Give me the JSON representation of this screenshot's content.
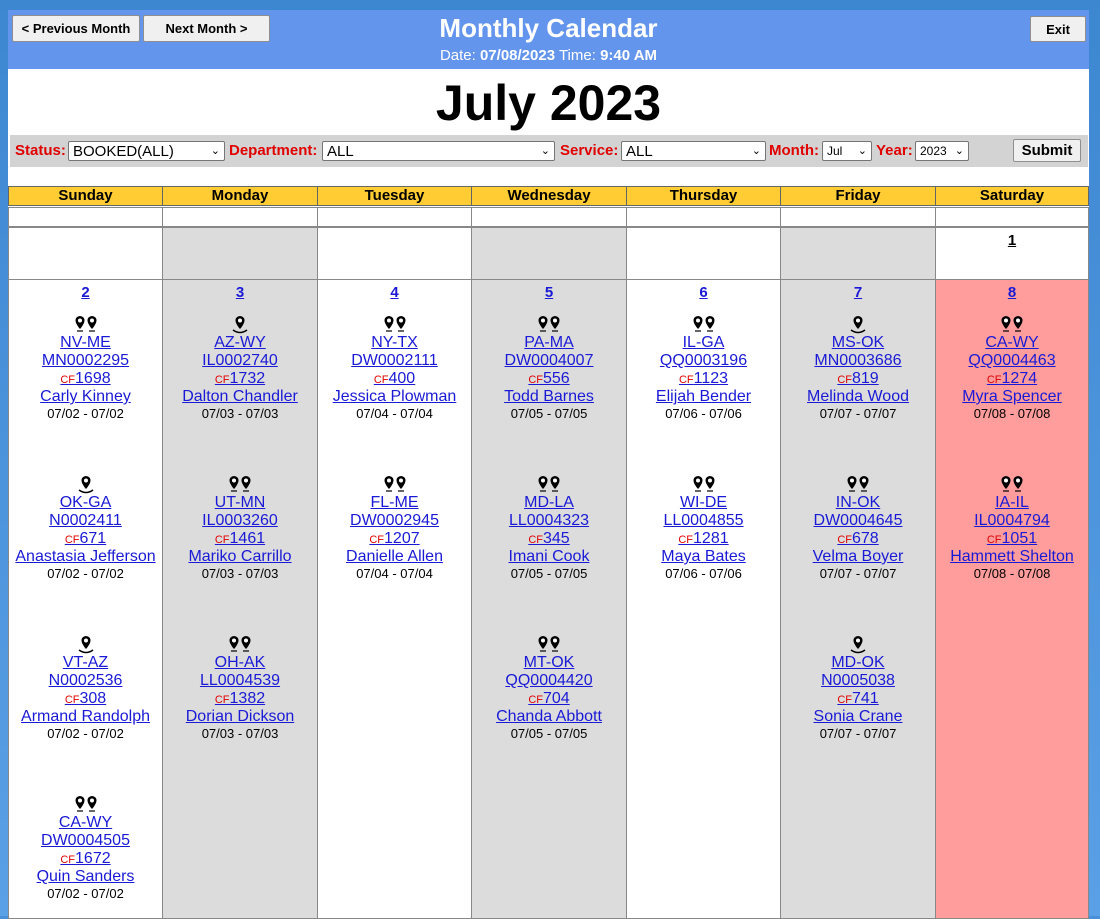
{
  "header": {
    "title": "Monthly Calendar",
    "date_label": "Date:",
    "date_value": "07/08/2023",
    "time_label": "Time:",
    "time_value": "9:40 AM",
    "prev_label": "< Previous Month",
    "next_label": "Next Month >",
    "exit_label": "Exit"
  },
  "month_title": "July 2023",
  "filters": {
    "status_label": "Status:",
    "status_value": "BOOKED(ALL)",
    "department_label": "Department:",
    "department_value": "ALL",
    "service_label": "Service:",
    "service_value": "ALL",
    "month_label": "Month:",
    "month_value": "Jul",
    "year_label": "Year:",
    "year_value": "2023",
    "submit_label": "Submit"
  },
  "weekdays": [
    "Sunday",
    "Monday",
    "Tuesday",
    "Wednesday",
    "Thursday",
    "Friday",
    "Saturday"
  ],
  "colors": {
    "header_bg": "#6495ed",
    "weekday_bg": "#ffcc33",
    "link": "#1a1ad6",
    "label_red": "#e00000",
    "today_bg": "#ff9c9c",
    "alt_bg": "#dcdcdc"
  },
  "row1": [
    {
      "day": ""
    },
    {
      "day": ""
    },
    {
      "day": ""
    },
    {
      "day": ""
    },
    {
      "day": ""
    },
    {
      "day": ""
    },
    {
      "day": "1"
    }
  ],
  "days": [
    {
      "day": "2",
      "entries": [
        {
          "pins": 2,
          "route": "NV-ME",
          "id": "MN0002295",
          "cf_label": "CF",
          "cf": "1698",
          "name": "Carly Kinney",
          "dates": "07/02 - 07/02"
        },
        {
          "pins": 1,
          "route": "OK-GA",
          "id": "N0002411",
          "cf_label": "CF",
          "cf": "671",
          "name": "Anastasia Jefferson",
          "dates": "07/02 - 07/02"
        },
        {
          "pins": 1,
          "route": "VT-AZ",
          "id": "N0002536",
          "cf_label": "CF",
          "cf": "308",
          "name": "Armand Randolph",
          "dates": "07/02 - 07/02"
        },
        {
          "pins": 2,
          "route": "CA-WY",
          "id": "DW0004505",
          "cf_label": "CF",
          "cf": "1672",
          "name": "Quin Sanders",
          "dates": "07/02 - 07/02"
        }
      ]
    },
    {
      "day": "3",
      "entries": [
        {
          "pins": 1,
          "route": "AZ-WY",
          "id": "IL0002740",
          "cf_label": "CF",
          "cf": "1732",
          "name": "Dalton Chandler",
          "dates": "07/03 - 07/03"
        },
        {
          "pins": 2,
          "route": "UT-MN",
          "id": "IL0003260",
          "cf_label": "CF",
          "cf": "1461",
          "name": "Mariko Carrillo",
          "dates": "07/03 - 07/03"
        },
        {
          "pins": 2,
          "route": "OH-AK",
          "id": "LL0004539",
          "cf_label": "CF",
          "cf": "1382",
          "name": "Dorian Dickson",
          "dates": "07/03 - 07/03"
        }
      ]
    },
    {
      "day": "4",
      "entries": [
        {
          "pins": 2,
          "route": "NY-TX",
          "id": "DW0002111",
          "cf_label": "CF",
          "cf": "400",
          "name": "Jessica Plowman",
          "dates": "07/04 - 07/04"
        },
        {
          "pins": 2,
          "route": "FL-ME",
          "id": "DW0002945",
          "cf_label": "CF",
          "cf": "1207",
          "name": "Danielle Allen",
          "dates": "07/04 - 07/04"
        }
      ]
    },
    {
      "day": "5",
      "entries": [
        {
          "pins": 2,
          "route": "PA-MA",
          "id": "DW0004007",
          "cf_label": "CF",
          "cf": "556",
          "name": "Todd Barnes",
          "dates": "07/05 - 07/05"
        },
        {
          "pins": 2,
          "route": "MD-LA",
          "id": "LL0004323",
          "cf_label": "CF",
          "cf": "345",
          "name": "Imani Cook",
          "dates": "07/05 - 07/05"
        },
        {
          "pins": 2,
          "route": "MT-OK",
          "id": "QQ0004420",
          "cf_label": "CF",
          "cf": "704",
          "name": "Chanda Abbott",
          "dates": "07/05 - 07/05"
        }
      ]
    },
    {
      "day": "6",
      "entries": [
        {
          "pins": 2,
          "route": "IL-GA",
          "id": "QQ0003196",
          "cf_label": "CF",
          "cf": "1123",
          "name": "Elijah Bender",
          "dates": "07/06 - 07/06"
        },
        {
          "pins": 2,
          "route": "WI-DE",
          "id": "LL0004855",
          "cf_label": "CF",
          "cf": "1281",
          "name": "Maya Bates",
          "dates": "07/06 - 07/06"
        }
      ]
    },
    {
      "day": "7",
      "entries": [
        {
          "pins": 1,
          "route": "MS-OK",
          "id": "MN0003686",
          "cf_label": "CF",
          "cf": "819",
          "name": "Melinda Wood",
          "dates": "07/07 - 07/07"
        },
        {
          "pins": 2,
          "route": "IN-OK",
          "id": "DW0004645",
          "cf_label": "CF",
          "cf": "678",
          "name": "Velma Boyer",
          "dates": "07/07 - 07/07"
        },
        {
          "pins": 1,
          "route": "MD-OK",
          "id": "N0005038",
          "cf_label": "CF",
          "cf": "741",
          "name": "Sonia Crane",
          "dates": "07/07 - 07/07"
        }
      ]
    },
    {
      "day": "8",
      "entries": [
        {
          "pins": 2,
          "route": "CA-WY",
          "id": "QQ0004463",
          "cf_label": "CF",
          "cf": "1274",
          "name": "Myra Spencer",
          "dates": "07/08 - 07/08"
        },
        {
          "pins": 2,
          "route": "IA-IL",
          "id": "IL0004794",
          "cf_label": "CF",
          "cf": "1051",
          "name": "Hammett Shelton",
          "dates": "07/08 - 07/08"
        }
      ]
    }
  ]
}
